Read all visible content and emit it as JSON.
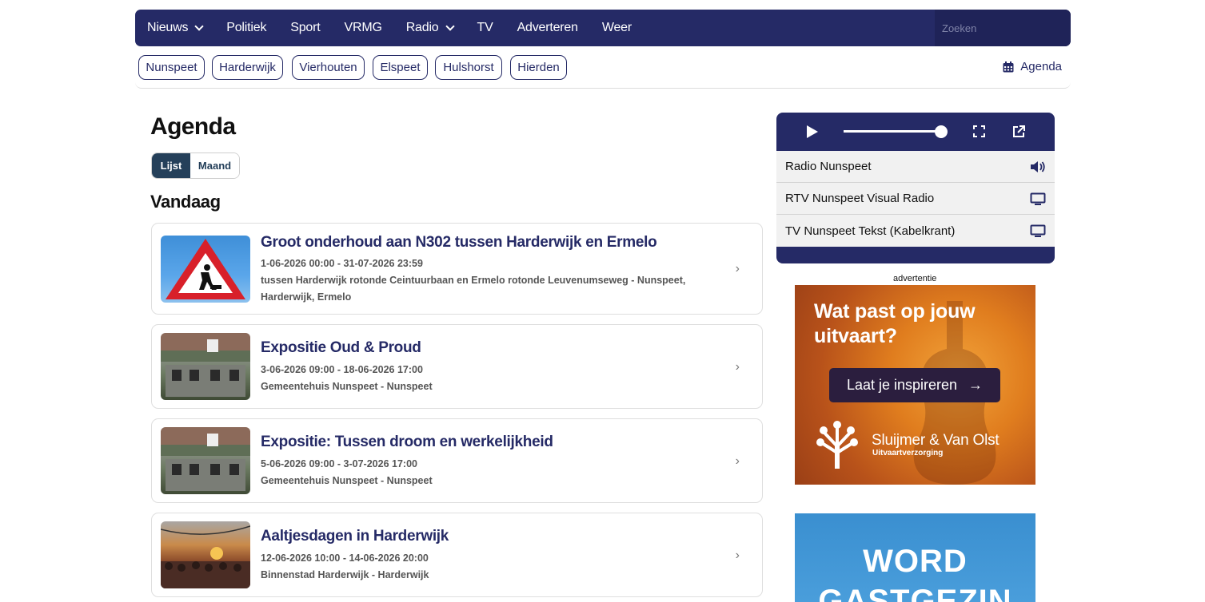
{
  "nav": {
    "items": [
      {
        "label": "Nieuws",
        "dropdown": true
      },
      {
        "label": "Politiek",
        "dropdown": false
      },
      {
        "label": "Sport",
        "dropdown": false
      },
      {
        "label": "VRMG",
        "dropdown": false
      },
      {
        "label": "Radio",
        "dropdown": true
      },
      {
        "label": "TV",
        "dropdown": false
      },
      {
        "label": "Adverteren",
        "dropdown": false
      },
      {
        "label": "Weer",
        "dropdown": false
      }
    ],
    "search_placeholder": "Zoeken"
  },
  "subnav": {
    "places": [
      "Nunspeet",
      "Harderwijk",
      "Vierhouten",
      "Elspeet",
      "Hulshorst",
      "Hierden"
    ],
    "agenda_label": "Agenda"
  },
  "main": {
    "title": "Agenda",
    "view_toggle": {
      "list": "Lijst",
      "month": "Maand",
      "active": "list"
    },
    "section_title": "Vandaag",
    "events": [
      {
        "title": "Groot onderhoud aan N302 tussen Harderwijk en Ermelo",
        "dates": "1-06-2026 00:00 - 31-07-2026 23:59",
        "location": "tussen Harderwijk rotonde Ceintuurbaan en Ermelo rotonde Leuvenumseweg - Nunspeet, Harderwijk, Ermelo",
        "thumb": "roadworks-sign"
      },
      {
        "title": "Expositie Oud & Proud",
        "dates": "3-06-2026 09:00 - 18-06-2026 17:00",
        "location": "Gemeentehuis Nunspeet - Nunspeet",
        "thumb": "town-hall"
      },
      {
        "title": "Expositie: Tussen droom en werkelijkheid",
        "dates": "5-06-2026 09:00 - 3-07-2026 17:00",
        "location": "Gemeentehuis Nunspeet - Nunspeet",
        "thumb": "town-hall"
      },
      {
        "title": "Aaltjesdagen in Harderwijk",
        "dates": "12-06-2026 10:00 - 14-06-2026 20:00",
        "location": "Binnenstad Harderwijk - Harderwijk",
        "thumb": "festival-crowd"
      }
    ],
    "arrow": "›"
  },
  "player": {
    "channels": [
      {
        "name": "Radio Nunspeet",
        "icon": "speaker-icon"
      },
      {
        "name": "RTV Nunspeet Visual Radio",
        "icon": "monitor-icon"
      },
      {
        "name": "TV Nunspeet Tekst (Kabelkrant)",
        "icon": "monitor-icon"
      }
    ],
    "volume": 1.0
  },
  "ads": {
    "label": "advertentie",
    "ad1": {
      "headline": "Wat past op jouw uitvaart?",
      "button": "Laat je inspireren",
      "brand": "Sluijmer & Van Olst",
      "sub": "Uitvaartverzorging"
    },
    "ad2": {
      "line1": "WORD",
      "line2": "GASTGEZIN"
    }
  },
  "colors": {
    "brand": "#252a66",
    "toggle_active": "#25405a"
  }
}
